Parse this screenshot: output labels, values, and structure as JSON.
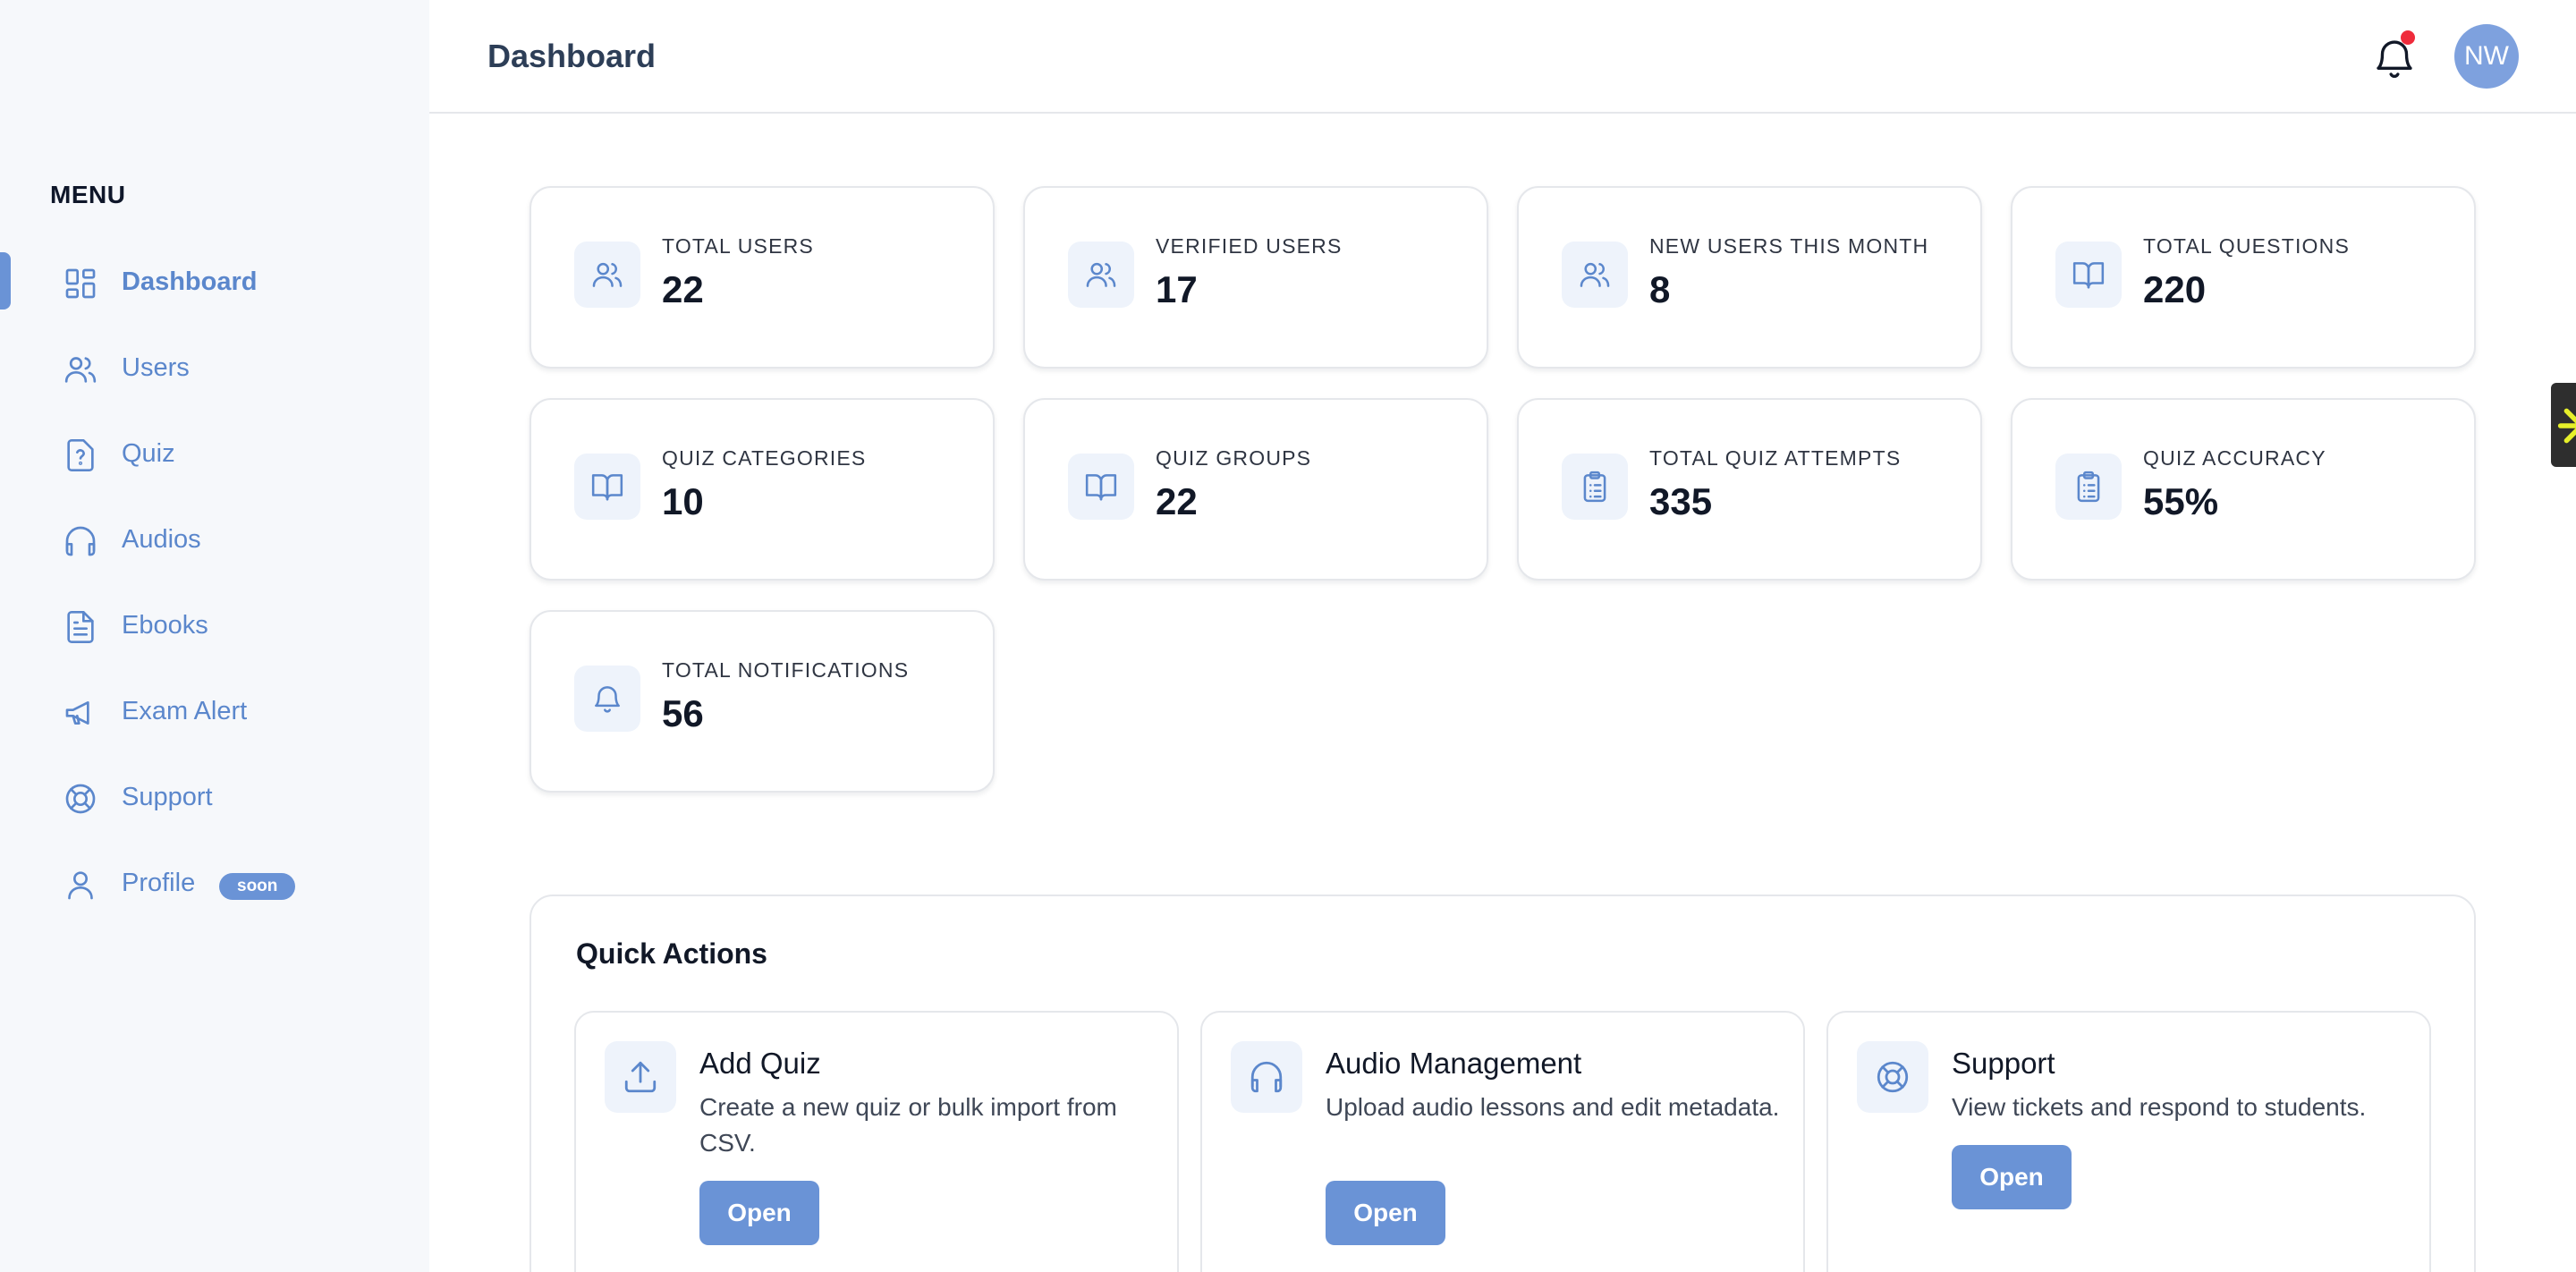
{
  "sidebar": {
    "menu_title": "MENU",
    "items": [
      {
        "label": "Dashboard",
        "icon": "dashboard-icon",
        "active": true
      },
      {
        "label": "Users",
        "icon": "users-icon"
      },
      {
        "label": "Quiz",
        "icon": "quiz-icon"
      },
      {
        "label": "Audios",
        "icon": "headphones-icon"
      },
      {
        "label": "Ebooks",
        "icon": "document-icon"
      },
      {
        "label": "Exam Alert",
        "icon": "megaphone-icon"
      },
      {
        "label": "Support",
        "icon": "lifebuoy-icon"
      },
      {
        "label": "Profile",
        "icon": "user-icon",
        "badge": "soon"
      }
    ]
  },
  "header": {
    "title": "Dashboard",
    "notification_icon": "bell-icon",
    "avatar_initials": "NW"
  },
  "stats": [
    {
      "label": "TOTAL USERS",
      "value": "22",
      "icon": "users-icon"
    },
    {
      "label": "VERIFIED USERS",
      "value": "17",
      "icon": "users-icon"
    },
    {
      "label": "NEW USERS THIS MONTH",
      "value": "8",
      "icon": "users-icon"
    },
    {
      "label": "TOTAL QUESTIONS",
      "value": "220",
      "icon": "book-icon"
    },
    {
      "label": "QUIZ CATEGORIES",
      "value": "10",
      "icon": "book-icon"
    },
    {
      "label": "QUIZ GROUPS",
      "value": "22",
      "icon": "book-icon"
    },
    {
      "label": "TOTAL QUIZ ATTEMPTS",
      "value": "335",
      "icon": "clipboard-icon"
    },
    {
      "label": "QUIZ ACCURACY",
      "value": "55%",
      "icon": "clipboard-icon"
    },
    {
      "label": "TOTAL NOTIFICATIONS",
      "value": "56",
      "icon": "bell-icon"
    }
  ],
  "quick_actions": {
    "title": "Quick Actions",
    "items": [
      {
        "name": "Add Quiz",
        "description": "Create a new quiz or bulk import from CSV.",
        "button": "Open",
        "icon": "upload-icon"
      },
      {
        "name": "Audio Management",
        "description": "Upload audio lessons and edit metadata.",
        "button": "Open",
        "icon": "headphones-icon"
      },
      {
        "name": "Support",
        "description": "View tickets and respond to students.",
        "button": "Open",
        "icon": "lifebuoy-icon"
      }
    ]
  },
  "colors": {
    "accent": "#6a93d6",
    "sidebar_bg": "#f6f8fb",
    "notification_dot": "#ef2b3b",
    "avatar_bg": "#7ea1de"
  }
}
